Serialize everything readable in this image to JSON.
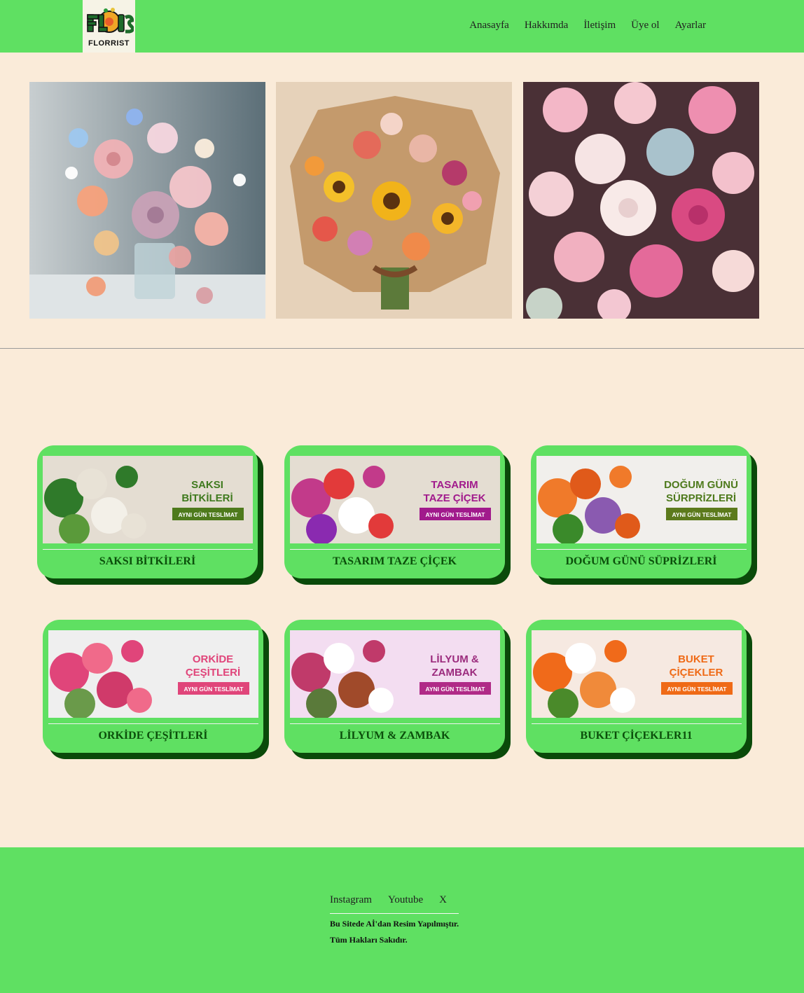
{
  "logo": {
    "main": "FLORS",
    "sub": "FLORRIST"
  },
  "nav": {
    "items": [
      "Anasayfa",
      "Hakkımda",
      "İletişim",
      "Üye ol",
      "Ayarlar"
    ]
  },
  "hero": {
    "images": [
      {
        "icon": "flower-vase-photo"
      },
      {
        "icon": "sunflower-bouquet-photo"
      },
      {
        "icon": "rose-peony-bouquet-photo"
      }
    ]
  },
  "categories": [
    {
      "label": "SAKSI BİTKİLERİ",
      "banner_title": [
        "SAKSI",
        "BİTKİLERİ"
      ],
      "badge": "AYNI GÜN TESLİMAT",
      "title_color": "#3f7a1e",
      "badge_color": "#4e7a1c",
      "bg": "#e4ddd2"
    },
    {
      "label": "TASARIM TAZE ÇİÇEK",
      "banner_title": [
        "TASARIM",
        "TAZE ÇİÇEK"
      ],
      "badge": "AYNI GÜN TESLİMAT",
      "title_color": "#a11a8c",
      "badge_color": "#a11a8c",
      "bg": "#e4ddd2"
    },
    {
      "label": "DOĞUM GÜNÜ SÜPRİZLERİ",
      "banner_title": [
        "DOĞUM GÜNÜ",
        "SÜRPRİZLERİ"
      ],
      "badge": "AYNI GÜN TESLİMAT",
      "title_color": "#4e7a1c",
      "badge_color": "#5c7a1c",
      "bg": "#f1efec"
    },
    {
      "label": "ORKİDE ÇEŞİTLERİ",
      "banner_title": [
        "ORKİDE",
        "ÇEŞİTLERİ"
      ],
      "badge": "AYNI GÜN TESLİMAT",
      "title_color": "#e0457a",
      "badge_color": "#e0457a",
      "bg": "#efefef"
    },
    {
      "label": "LİLYUM & ZAMBAK",
      "banner_title": [
        "LİLYUM &",
        "ZAMBAK"
      ],
      "badge": "AYNI GÜN TESLİMAT",
      "title_color": "#9b2b7d",
      "badge_color": "#b02a87",
      "bg": "#f3ddf1"
    },
    {
      "label": "BUKET ÇİÇEKLER11",
      "banner_title": [
        "BUKET",
        "ÇİÇEKLER"
      ],
      "badge": "AYNI GÜN TESLİMAT",
      "title_color": "#ef6a16",
      "badge_color": "#ef6a16",
      "bg": "#f6e9e1"
    }
  ],
  "footer": {
    "links": [
      "Instagram",
      "Youtube",
      "X"
    ],
    "note_1": "Bu Sitede Aİ'dan Resim Yapılmıştır.",
    "note_2": "Tüm Hakları Sakıdır."
  },
  "colors": {
    "header_bg": "#5fe062",
    "page_bg": "#faebd9",
    "card_shadow": "#0a4a0a",
    "card_label": "#0b4f0b"
  }
}
